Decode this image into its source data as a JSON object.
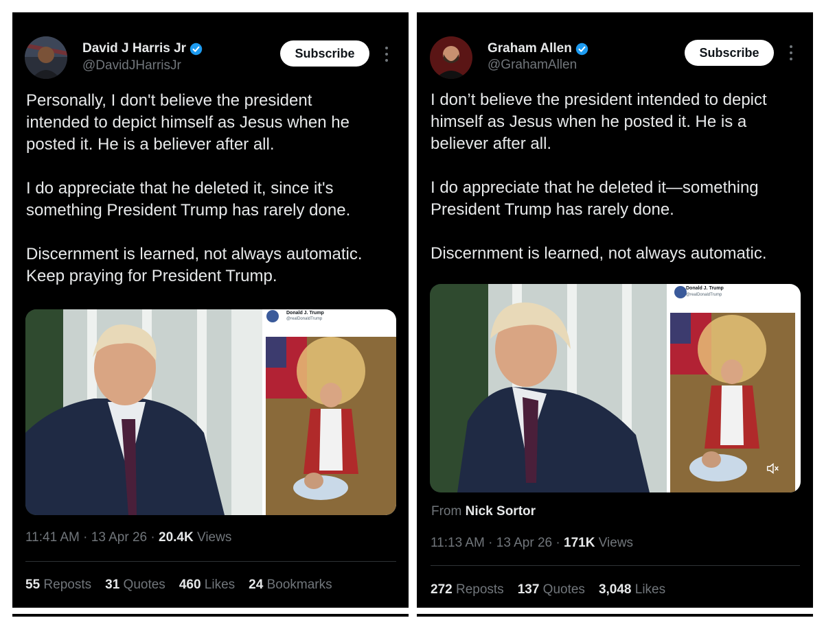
{
  "left": {
    "name": "David J Harris Jr",
    "handle": "@DavidJHarrisJr",
    "subscribe_label": "Subscribe",
    "body": [
      "Personally, I don't believe the president",
      "intended to depict himself as Jesus when he",
      "posted it. He is a believer after all.",
      "",
      "I do appreciate that he deleted it, since it's",
      "something President Trump has rarely done.",
      "",
      "Discernment is learned, not always automatic.",
      "Keep praying for President Trump."
    ],
    "embed_name": "Donald J. Trump",
    "embed_handle": "@realDonaldTrump",
    "time": "11:41 AM",
    "date": "13 Apr 26",
    "views_count": "20.4K",
    "views_label": "Views",
    "reposts_count": "55",
    "reposts_label": "Reposts",
    "quotes_count": "31",
    "quotes_label": "Quotes",
    "likes_count": "460",
    "likes_label": "Likes",
    "bookmarks_count": "24",
    "bookmarks_label": "Bookmarks"
  },
  "right": {
    "name": "Graham Allen",
    "handle": "@GrahamAllen",
    "subscribe_label": "Subscribe",
    "body": [
      "I don’t believe the president intended to depict",
      "himself as Jesus when he posted it. He is a",
      "believer after all.",
      "",
      "I do appreciate that he deleted it—something",
      "President Trump has rarely done.",
      "",
      "Discernment is learned, not always automatic."
    ],
    "embed_name": "Donald J. Trump",
    "embed_handle": "@realDonaldTrump",
    "from_label": "From",
    "from_name": "Nick Sortor",
    "time": "11:13 AM",
    "date": "13 Apr 26",
    "views_count": "171K",
    "views_label": "Views",
    "reposts_count": "272",
    "reposts_label": "Reposts",
    "quotes_count": "137",
    "quotes_label": "Quotes",
    "likes_count": "3,048",
    "likes_label": "Likes"
  },
  "colors": {
    "background": "#000000",
    "verified": "#1d9bf0",
    "muted": "#71767b",
    "text": "#e7e9ea"
  },
  "icons": [
    "verified-badge-icon",
    "more-options-icon",
    "mute-icon"
  ]
}
